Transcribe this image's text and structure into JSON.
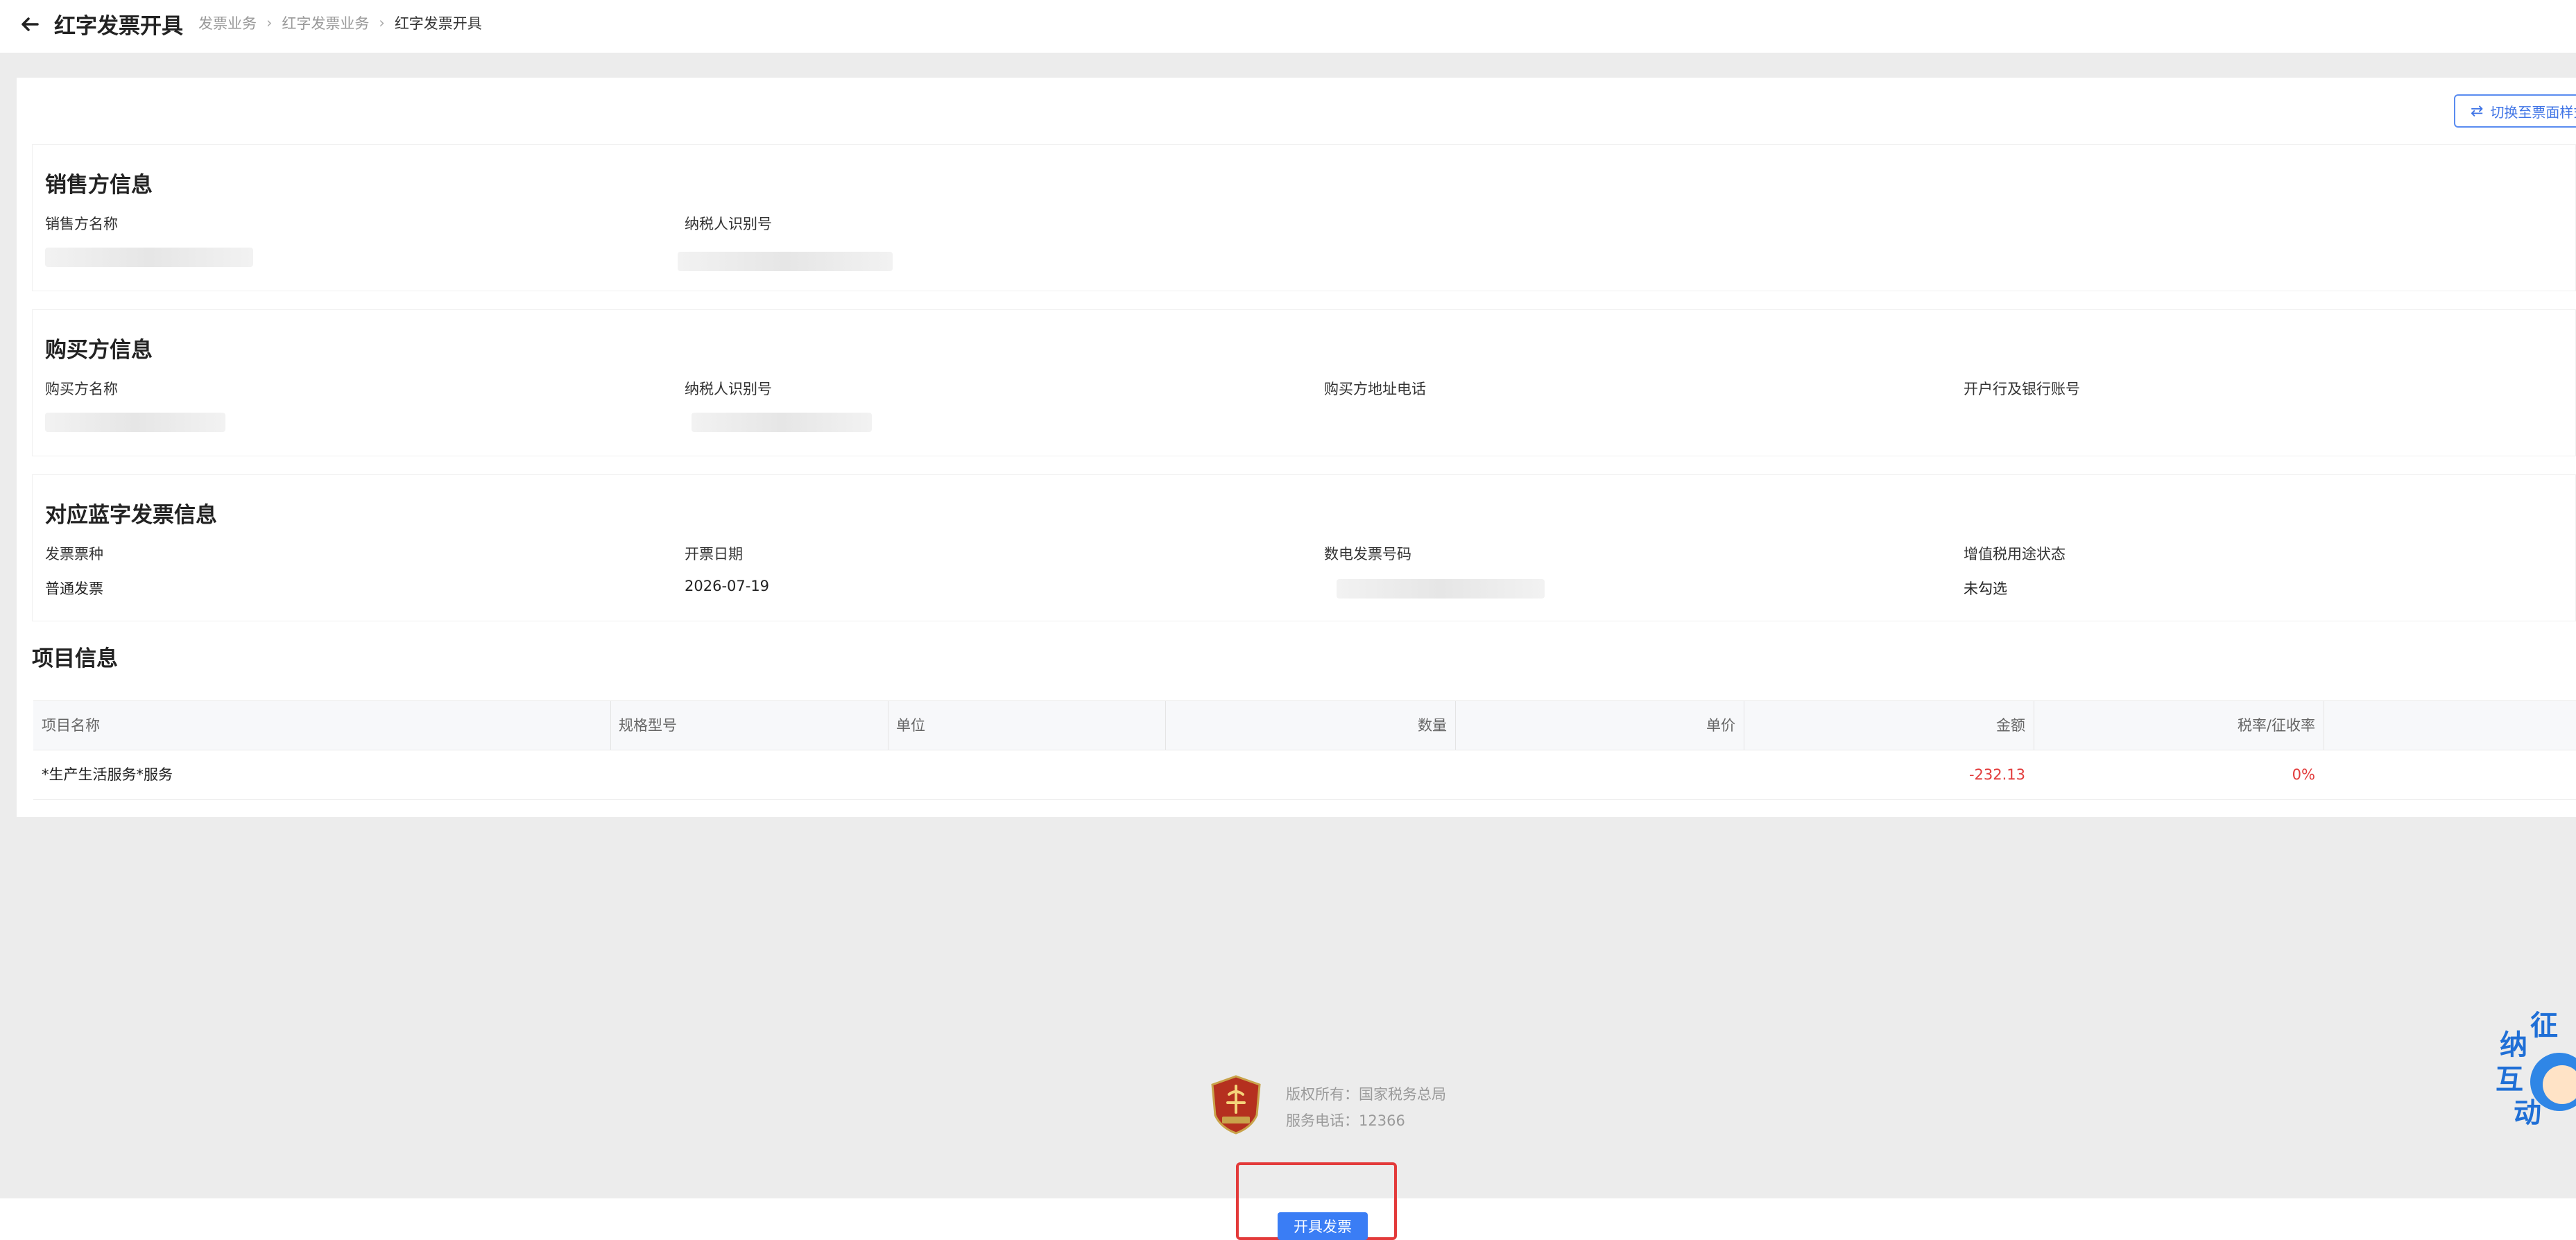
{
  "header": {
    "title": "红字发票开具",
    "breadcrumb": [
      "发票业务",
      "红字发票业务",
      "红字发票开具"
    ]
  },
  "switch_button": {
    "label": "切换至票面样式"
  },
  "seller": {
    "title": "销售方信息",
    "name_label": "销售方名称",
    "tax_id_label": "纳税人识别号"
  },
  "buyer": {
    "title": "购买方信息",
    "name_label": "购买方名称",
    "tax_id_label": "纳税人识别号",
    "address_label": "购买方地址电话",
    "bank_label": "开户行及银行账号"
  },
  "blue_invoice": {
    "title": "对应蓝字发票信息",
    "type_label": "发票票种",
    "type_value": "普通发票",
    "date_label": "开票日期",
    "date_value": "2026-07-19",
    "number_label": "数电发票号码",
    "vat_label": "增值税用途状态",
    "vat_value": "未勾选"
  },
  "items": {
    "title": "项目信息",
    "columns": [
      "项目名称",
      "规格型号",
      "单位",
      "数量",
      "单价",
      "金额",
      "税率/征收率"
    ],
    "rows": [
      {
        "name": "*生产生活服务*服务",
        "spec": "",
        "unit": "",
        "qty": "",
        "price": "",
        "amount": "-232.13",
        "rate": "0%"
      }
    ]
  },
  "footer": {
    "copyright": "版权所有：国家税务总局",
    "phone": "服务电话：12366"
  },
  "issue_button": {
    "label": "开具发票"
  },
  "colors": {
    "accent": "#3a7df5",
    "negative": "#e23b3b",
    "highlight_box": "#e33a3a"
  }
}
